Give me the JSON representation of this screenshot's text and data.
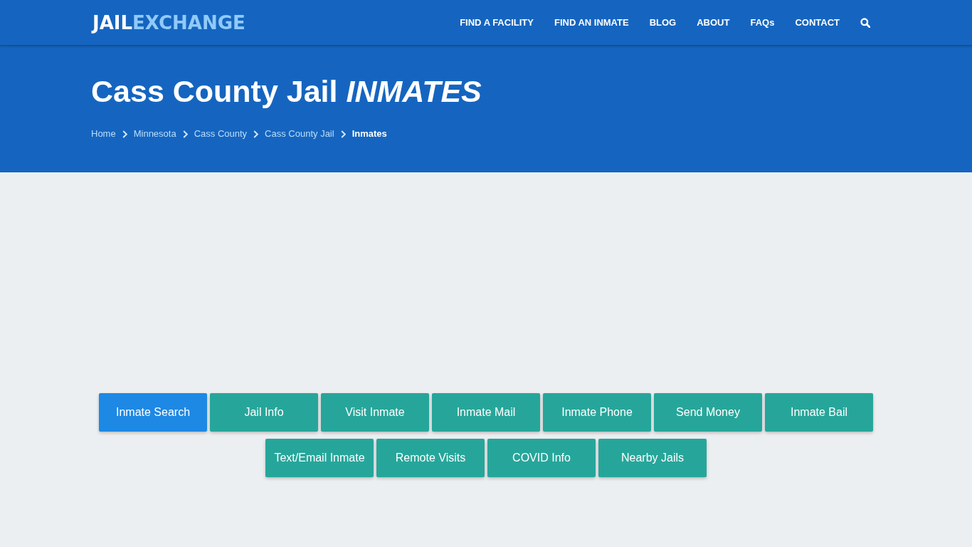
{
  "header": {
    "logo": {
      "part_1": "JAIL",
      "part_2": "EXCHANGE"
    },
    "nav": [
      "FIND A FACILITY",
      "FIND AN INMATE",
      "BLOG",
      "ABOUT",
      "FAQs",
      "CONTACT"
    ]
  },
  "hero": {
    "title": "Cass County Jail *INMATES*",
    "breadcrumb": [
      {
        "label": "Home",
        "current": false
      },
      {
        "label": "Minnesota",
        "current": false
      },
      {
        "label": "Cass County",
        "current": false
      },
      {
        "label": "Cass County Jail",
        "current": false
      },
      {
        "label": "Inmates",
        "current": true
      }
    ]
  },
  "tabs": [
    {
      "label": "Inmate Search",
      "selected": true
    },
    {
      "label": "Jail Info",
      "selected": false
    },
    {
      "label": "Visit Inmate",
      "selected": false
    },
    {
      "label": "Inmate Mail",
      "selected": false
    },
    {
      "label": "Inmate Phone",
      "selected": false
    },
    {
      "label": "Send Money",
      "selected": false
    },
    {
      "label": "Inmate Bail",
      "selected": false
    },
    {
      "label": "Text/Email Inmate",
      "selected": false
    },
    {
      "label": "Remote Visits",
      "selected": false
    },
    {
      "label": "COVID Info",
      "selected": false
    },
    {
      "label": "Nearby Jails",
      "selected": false
    }
  ]
}
